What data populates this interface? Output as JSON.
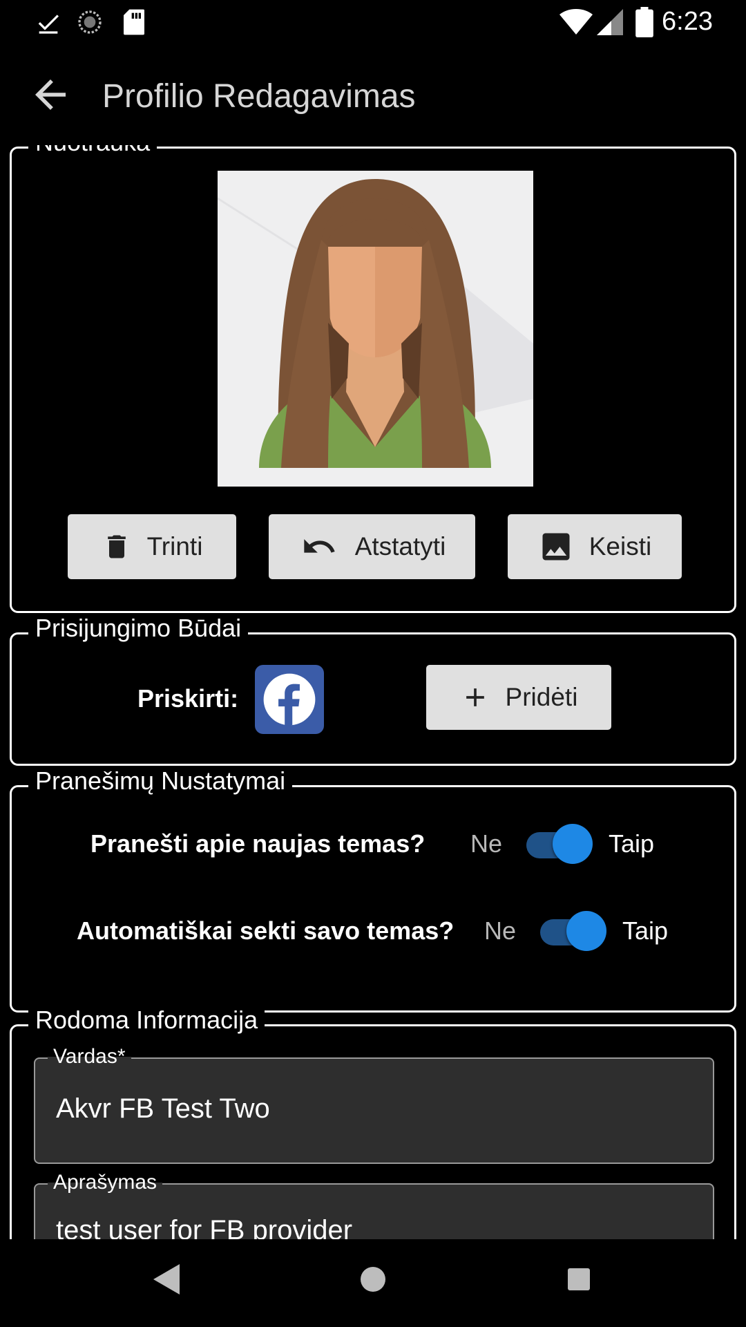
{
  "status_bar": {
    "time": "6:23",
    "icons": [
      "download-done-icon",
      "sync-icon",
      "sd-card-icon",
      "wifi-icon",
      "signal-icon",
      "battery-icon"
    ]
  },
  "app_bar": {
    "title": "Profilio Redagavimas",
    "back_icon": "arrow-left-icon"
  },
  "photo_section": {
    "legend": "Nuotrauka",
    "delete_label": "Trinti",
    "reset_label": "Atstatyti",
    "change_label": "Keisti"
  },
  "login_section": {
    "legend": "Prisijungimo Būdai",
    "assigned_label": "Priskirti:",
    "add_label": "Pridėti",
    "providers": [
      "facebook-icon"
    ]
  },
  "notification_section": {
    "legend": "Pranešimų Nustatymai",
    "settings": [
      {
        "label": "Pranešti apie naujas temas?",
        "no": "Ne",
        "yes": "Taip",
        "enabled": true
      },
      {
        "label": "Automatiškai sekti savo temas?",
        "no": "Ne",
        "yes": "Taip",
        "enabled": true
      }
    ]
  },
  "info_section": {
    "legend": "Rodoma Informacija",
    "name_label": "Vardas*",
    "name_value": "Akvr FB Test Two",
    "description_label": "Aprašymas",
    "description_value": "test user for FB provider"
  },
  "colors": {
    "background": "#000000",
    "button": "#e0e0e0",
    "accent": "#1e88e5",
    "facebook": "#3b5ca8",
    "field_bg": "#2e2e2e"
  }
}
